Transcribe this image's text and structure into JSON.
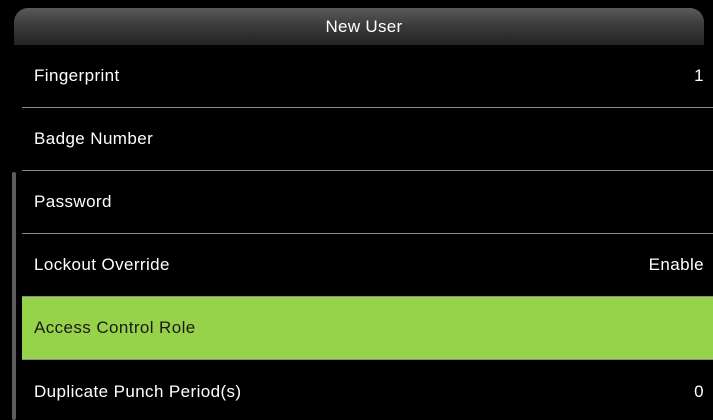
{
  "header": {
    "title": "New User"
  },
  "menu": {
    "items": [
      {
        "label": "Fingerprint",
        "value": "1"
      },
      {
        "label": "Badge Number",
        "value": ""
      },
      {
        "label": "Password",
        "value": ""
      },
      {
        "label": "Lockout Override",
        "value": "Enable"
      },
      {
        "label": "Access Control Role",
        "value": "",
        "selected": true
      },
      {
        "label": "Duplicate Punch Period(s)",
        "value": "0"
      }
    ]
  },
  "colors": {
    "background": "#000000",
    "selected_row": "#96d24a",
    "text": "#ffffff",
    "divider": "#8a8a8a"
  }
}
